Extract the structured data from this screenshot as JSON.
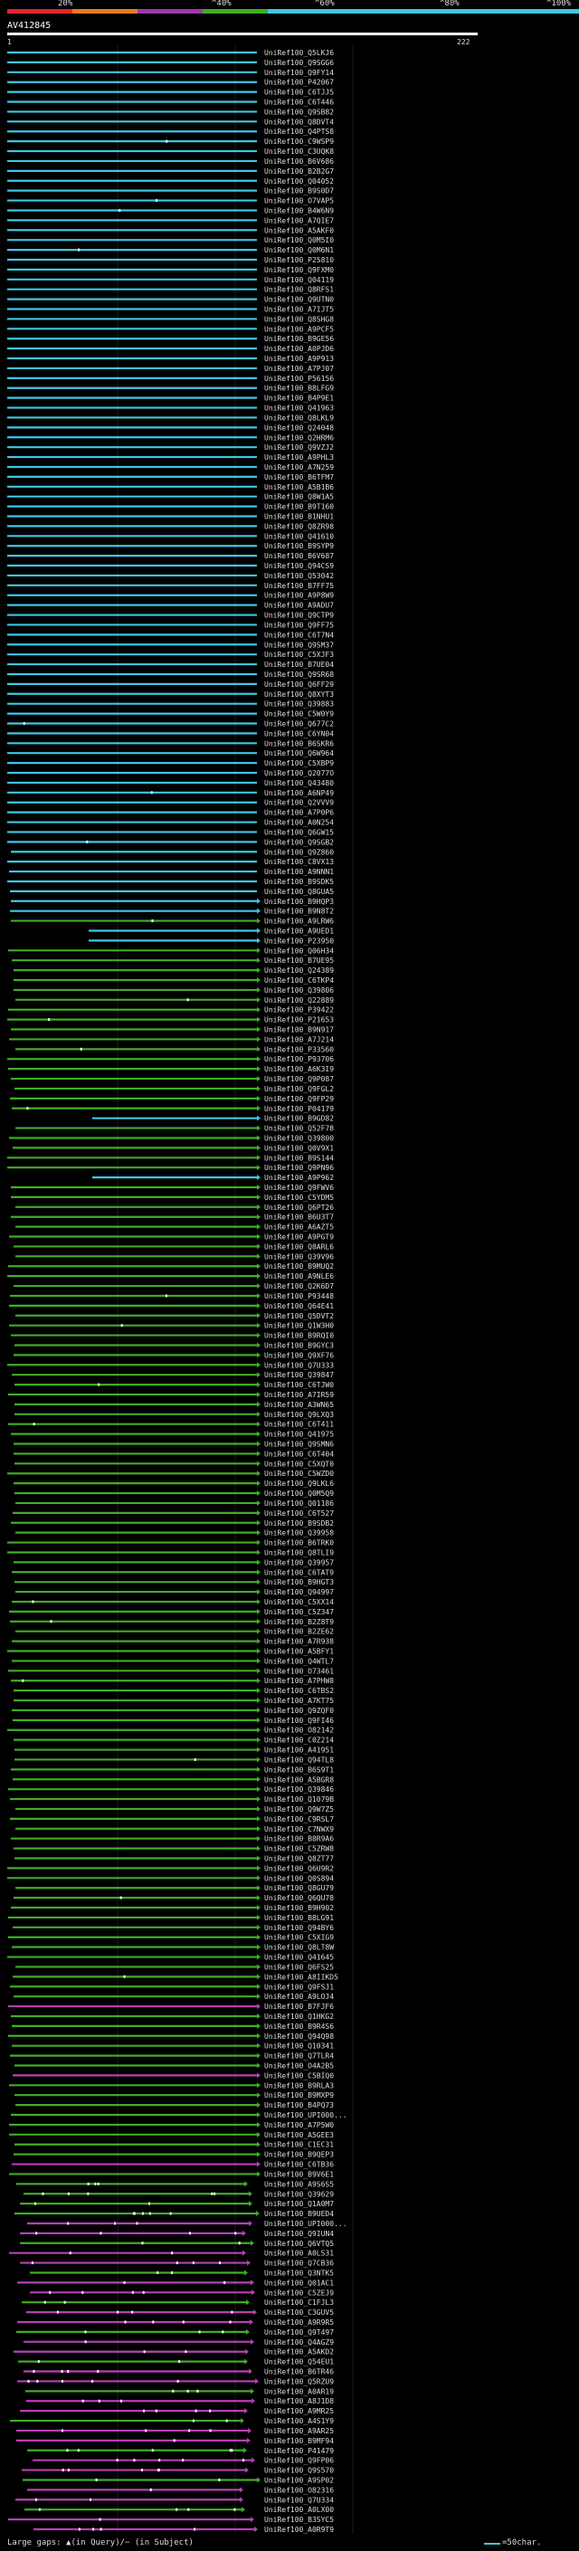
{
  "header": {
    "legend_labels": [
      "20%",
      "^40%",
      "^60%",
      "^80%",
      "^100%"
    ],
    "legend_colors": [
      "#e2262b",
      "#e97b1f",
      "#9b3aa9",
      "#3fad26",
      "#3ec7e3"
    ],
    "query_name": "AV412845",
    "query_start": "1",
    "query_end": "222"
  },
  "colors": {
    "cyan": "#3ec7e3",
    "green": "#3fad26",
    "magenta": "#b83fb6",
    "gap": "#ffffff",
    "background": "#000000"
  },
  "hits": [
    "UniRef100_Q5LKJ6",
    "UniRef100_Q9SGG6",
    "UniRef100_Q9FY14",
    "UniRef100_P42067",
    "UniRef100_C6TJJ5",
    "UniRef100_C6T446",
    "UniRef100_Q9SB82",
    "UniRef100_Q8DVT4",
    "UniRef100_Q4PTS8",
    "UniRef100_C9WSP9",
    "UniRef100_C3UQK8",
    "UniRef100_B6V686",
    "UniRef100_B2B2G7",
    "UniRef100_Q04052",
    "UniRef100_B9S0D7",
    "UniRef100_O7VAP5",
    "UniRef100_B4W6N9",
    "UniRef100_A7QIE7",
    "UniRef100_A5AKF0",
    "UniRef100_Q0M5I0",
    "UniRef100_Q0M6N1",
    "UniRef100_P25810",
    "UniRef100_Q9FXM0",
    "UniRef100_Q04119",
    "UniRef100_Q8RFS1",
    "UniRef100_Q9UTN0",
    "UniRef100_A7IJT5",
    "UniRef100_Q8SHG8",
    "UniRef100_A9PCF5",
    "UniRef100_B9GE56",
    "UniRef100_A0PJD6",
    "UniRef100_A9P913",
    "UniRef100_A7PJ07",
    "UniRef100_P56156",
    "UniRef100_B8LFG9",
    "UniRef100_B4P9E1",
    "UniRef100_Q41963",
    "UniRef100_Q8LKL9",
    "UniRef100_Q24048",
    "UniRef100_Q2HRM6",
    "UniRef100_Q9VZJ2",
    "UniRef100_A9PHL3",
    "UniRef100_A7N259",
    "UniRef100_B6TFM7",
    "UniRef100_A5B1B6",
    "UniRef100_Q8W1A5",
    "UniRef100_B9T160",
    "UniRef100_B1NHU1",
    "UniRef100_Q8ZR98",
    "UniRef100_Q41610",
    "UniRef100_B9SYP9",
    "UniRef100_B6V687",
    "UniRef100_Q94CS9",
    "UniRef100_Q53042",
    "UniRef100_B7FF75",
    "UniRef100_A9P8W9",
    "UniRef100_A9ADU7",
    "UniRef100_Q9CTP9",
    "UniRef100_Q9FF75",
    "UniRef100_C6T7N4",
    "UniRef100_Q9SM37",
    "UniRef100_C5XJF3",
    "UniRef100_B7UE04",
    "UniRef100_Q9SR68",
    "UniRef100_Q6FF29",
    "UniRef100_Q8XYT3",
    "UniRef100_Q39883",
    "UniRef100_C5W0Y9",
    "UniRef100_Q677C2",
    "UniRef100_C6YN04",
    "UniRef100_B6SKR6",
    "UniRef100_Q6W964",
    "UniRef100_C5XBP9",
    "UniRef100_Q2077O",
    "UniRef100_Q43480",
    "UniRef100_A6NP49",
    "UniRef100_Q2VVV9",
    "UniRef100_A7P0P6",
    "UniRef100_A0N254",
    "UniRef100_Q6GW15",
    "UniRef100_Q9SGB2",
    "UniRef100_Q9Z860",
    "UniRef100_C8VX13",
    "UniRef100_A9NNN1",
    "UniRef100_B9SDK5",
    "UniRef100_Q8GUA5",
    "UniRef100_B9HQP3",
    "UniRef100_B9N8T2",
    "UniRef100_A9LRW6",
    "UniRef100_A9UED1",
    "UniRef100_P23950",
    "UniRef100_Q06H34",
    "UniRef100_B7UE95",
    "UniRef100_Q24389",
    "UniRef100_C6TKP4",
    "UniRef100_Q39806",
    "UniRef100_Q22889",
    "UniRef100_P39422",
    "UniRef100_P21653",
    "UniRef100_B9N917",
    "UniRef100_A7J214",
    "UniRef100_P33560",
    "UniRef100_P93706",
    "UniRef100_A6K3I9",
    "UniRef100_Q9P087",
    "UniRef100_Q9FGL2",
    "UniRef100_Q9FP29",
    "UniRef100_P04179",
    "UniRef100_B9GD82",
    "UniRef100_Q52F78",
    "UniRef100_Q39800",
    "UniRef100_Q0V9X1",
    "UniRef100_B9S144",
    "UniRef100_Q9PN96",
    "UniRef100_A9P962",
    "UniRef100_Q9FWV6",
    "UniRef100_C5YDM5",
    "UniRef100_Q6PT26",
    "UniRef100_B6U3T7",
    "UniRef100_A6AZT5",
    "UniRef100_A9PGT9",
    "UniRef100_Q8ARL6",
    "UniRef100_Q39V96",
    "UniRef100_B9MUQ2",
    "UniRef100_A9NLE6",
    "UniRef100_Q2K6D7",
    "UniRef100_P93448",
    "UniRef100_Q64E41",
    "UniRef100_Q5DVT2",
    "UniRef100_Q1W3H0",
    "UniRef100_B9RQI0",
    "UniRef100_B9GYC3",
    "UniRef100_Q9XF76",
    "UniRef100_Q7U333",
    "UniRef100_Q39847",
    "UniRef100_C6TJW0",
    "UniRef100_A7IR59",
    "UniRef100_A3WN65",
    "UniRef100_Q9LXQ3",
    "UniRef100_C6T411",
    "UniRef100_Q41975",
    "UniRef100_Q9SMN6",
    "UniRef100_C6T404",
    "UniRef100_C5XQT0",
    "UniRef100_C5WZD0",
    "UniRef100_Q9LKL6",
    "UniRef100_Q0M5Q9",
    "UniRef100_Q01186",
    "UniRef100_C6T527",
    "UniRef100_B9SDB2",
    "UniRef100_Q39958",
    "UniRef100_B6TRK0",
    "UniRef100_Q8TLI9",
    "UniRef100_Q39957",
    "UniRef100_C6TAT9",
    "UniRef100_B9HGT3",
    "UniRef100_Q94997",
    "UniRef100_C5XX14",
    "UniRef100_C5Z347",
    "UniRef100_B2Z8T9",
    "UniRef100_B2ZE62",
    "UniRef100_A7R938",
    "UniRef100_A5BFY1",
    "UniRef100_Q4WTL7",
    "UniRef100_O73461",
    "UniRef100_A7PHW8",
    "UniRef100_C6TBS2",
    "UniRef100_A7KT75",
    "UniRef100_Q9ZQF0",
    "UniRef100_Q9FI46",
    "UniRef100_O82142",
    "UniRef100_C0Z214",
    "UniRef100_A41951",
    "UniRef100_Q94TL8",
    "UniRef100_B6S9T1",
    "UniRef100_A5BGR8",
    "UniRef100_Q39846",
    "UniRef100_Q1079B",
    "UniRef100_Q9W7Z5",
    "UniRef100_C9RSL7",
    "UniRef100_C7NWX9",
    "UniRef100_B8R9A6",
    "UniRef100_C5ZRW8",
    "UniRef100_Q8ZT77",
    "UniRef100_Q6U9R2",
    "UniRef100_Q0S894",
    "UniRef100_Q8GU79",
    "UniRef100_Q6QU78",
    "UniRef100_B9H902",
    "UniRef100_B8LG91",
    "UniRef100_Q94BY6",
    "UniRef100_C5XIG9",
    "UniRef100_Q8LT8W",
    "UniRef100_Q41645",
    "UniRef100_Q6FS25",
    "UniRef100_A8IIKD5",
    "UniRef100_Q9FSJ1",
    "UniRef100_A9LOJ4",
    "UniRef100_B7FJF6",
    "UniRef100_Q1HKG2",
    "UniRef100_B9R4S6",
    "UniRef100_Q94Q98",
    "UniRef100_Q10341",
    "UniRef100_Q7TLR4",
    "UniRef100_O4A2B5",
    "UniRef100_C5BIQ0",
    "UniRef100_B9RLA3",
    "UniRef100_B9MXP9",
    "UniRef100_B4PQ73",
    "UniRef100_UPI000...",
    "UniRef100_A7P5W0",
    "UniRef100_A5GEE3",
    "UniRef100_C1EC31",
    "UniRef100_B9QEP3",
    "UniRef100_C6TB36",
    "UniRef100_B9V6E1",
    "UniRef100_A9S6S5",
    "UniRef100_Q39629",
    "UniRef100_Q1A0M7",
    "UniRef100_B9UED4",
    "UniRef100_UPI000...",
    "UniRef100_Q9IUN4",
    "UniRef100_Q6VTQ5",
    "UniRef100_A0LS31",
    "UniRef100_Q7CB36",
    "UniRef100_Q3NTK5",
    "UniRef100_Q01AC1",
    "UniRef100_C5ZEJ9",
    "UniRef100_C1FJL3",
    "UniRef100_C3GUV5",
    "UniRef100_A9R9R5",
    "UniRef100_Q9T497",
    "UniRef100_Q4AGZ9",
    "UniRef100_A5AKD2",
    "UniRef100_Q54EU1",
    "UniRef100_B6TR46",
    "UniRef100_Q5RZU9",
    "UniRef100_A0AR19",
    "UniRef100_A8J1D8",
    "UniRef100_A9MR25",
    "UniRef100_A4S1Y9",
    "UniRef100_A9AR25",
    "UniRef100_B9MF94",
    "UniRef100_P41479",
    "UniRef100_Q9FP06",
    "UniRef100_Q9S570",
    "UniRef100_A9SP02",
    "UniRef100_O82316",
    "UniRef100_Q7U334",
    "UniRef100_A0LX00",
    "UniRef100_B3SYC5",
    "UniRef100_A0R9T9"
  ],
  "footer": {
    "gaps_text": "Large gaps: ▲(in Query)/− (in Subject)",
    "scale_text": "=50char."
  }
}
